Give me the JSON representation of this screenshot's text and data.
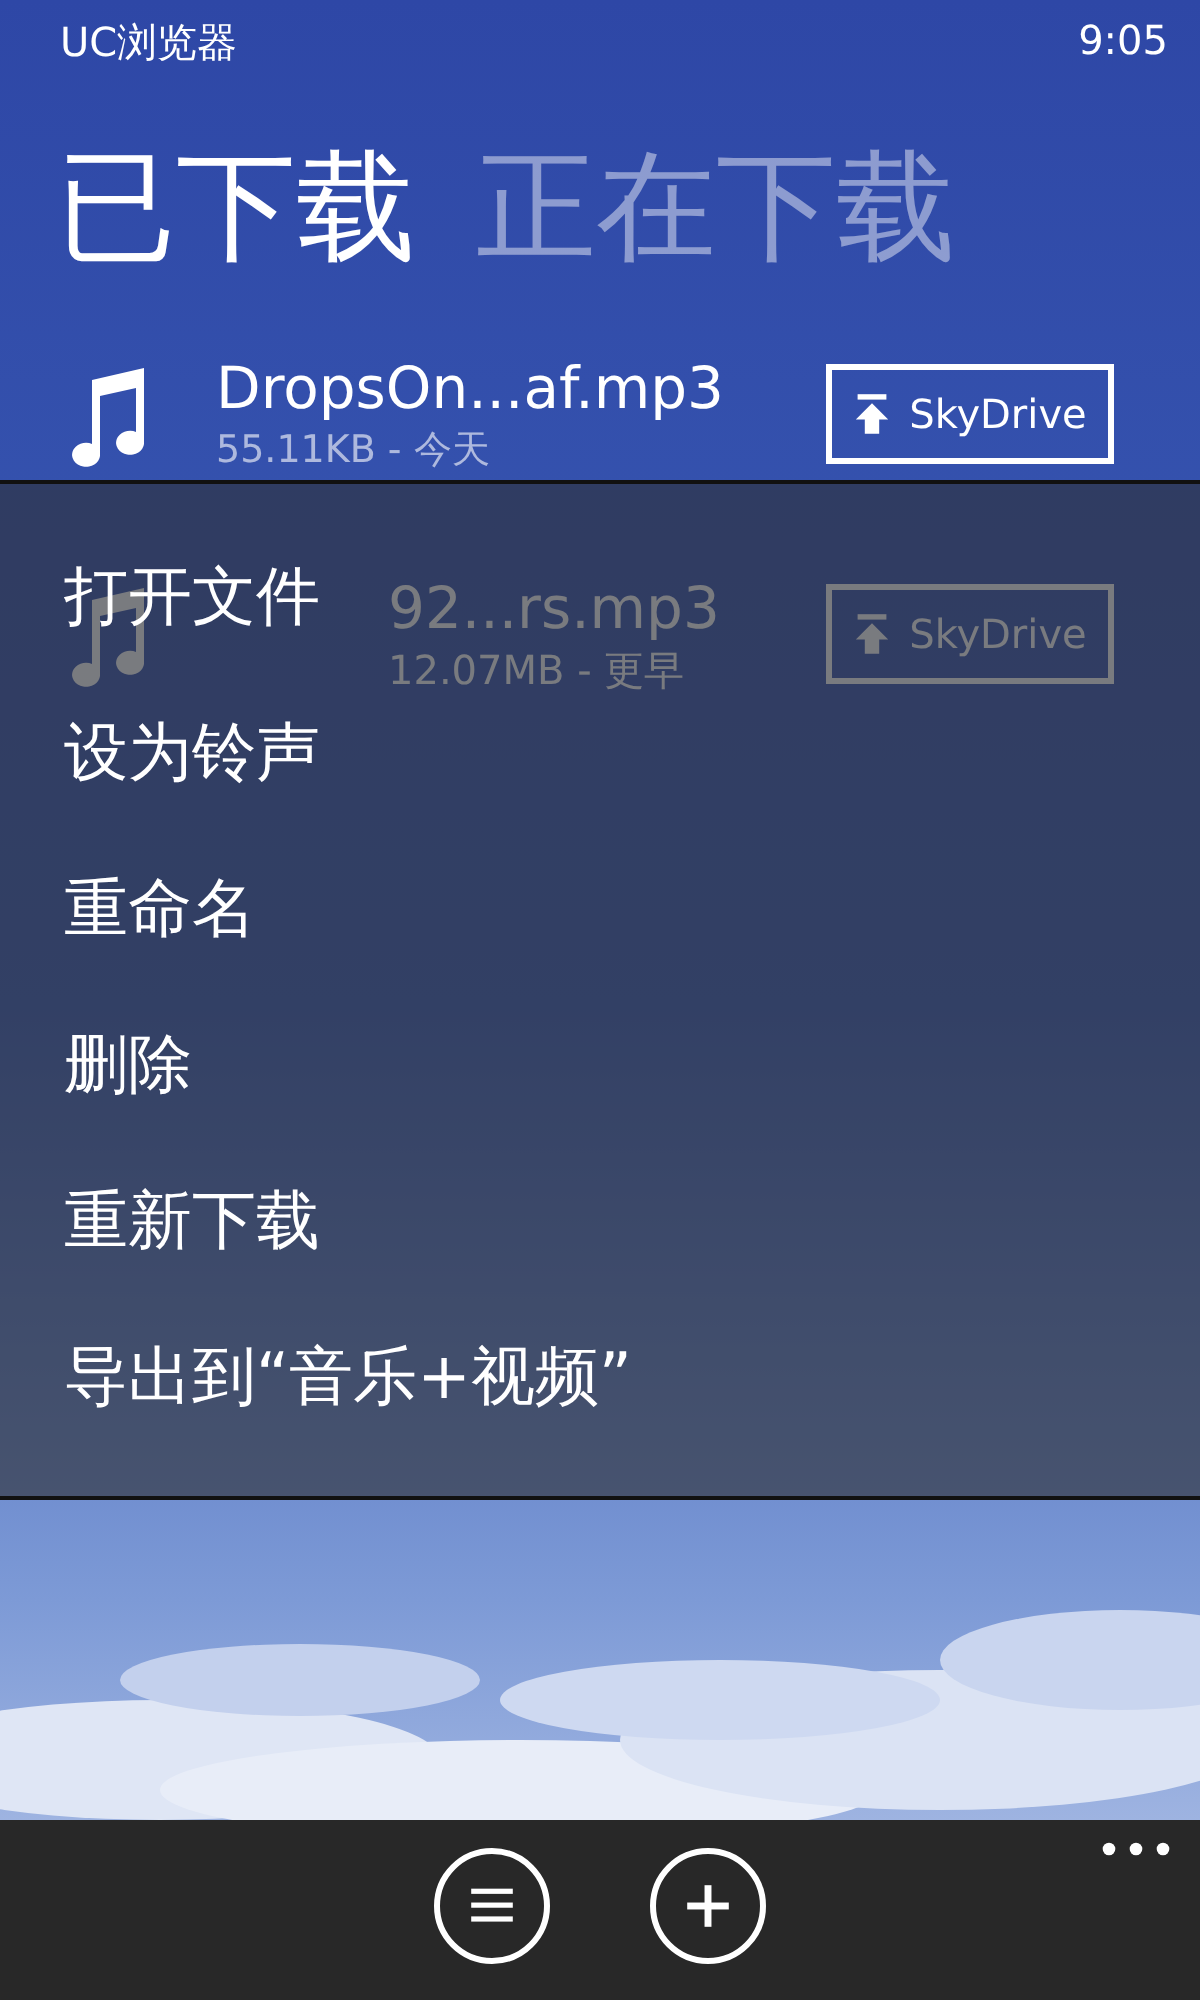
{
  "status_bar": {
    "app": "UC浏览器",
    "time": "9:05"
  },
  "pivot": [
    {
      "label": "已下载",
      "selected": true
    },
    {
      "label": "正在下载",
      "selected": false
    }
  ],
  "downloads": [
    {
      "title": "DropsOn...af.mp3",
      "detail": "55.11KB - 今天",
      "action": "SkyDrive"
    },
    {
      "title": "92...rs.mp3",
      "detail": "12.07MB - 更早",
      "action": "SkyDrive"
    }
  ],
  "context_menu": [
    "打开文件",
    "设为铃声",
    "重命名",
    "删除",
    "重新下载",
    "导出到“音乐+视频”"
  ],
  "app_bar": {
    "buttons": [
      {
        "kind": "list"
      },
      {
        "kind": "add"
      }
    ]
  }
}
